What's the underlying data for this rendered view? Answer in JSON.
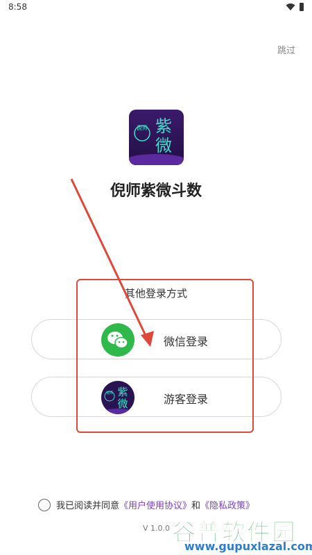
{
  "status": {
    "time": "8:58"
  },
  "header": {
    "skip_label": "跳过"
  },
  "app": {
    "name": "倪师紫微斗数",
    "logo_small": "倪师",
    "logo_big_1": "紫",
    "logo_big_2": "微"
  },
  "login": {
    "other_methods_title": "其他登录方式",
    "wechat_label": "微信登录",
    "guest_label": "游客登录"
  },
  "agreement": {
    "prefix": "我已阅读并同意",
    "user_agreement": "《用户使用协议》",
    "and": "和",
    "privacy_policy": "《隐私政策》"
  },
  "version": "V 1.0.0",
  "watermark": {
    "big": "谷普软件园",
    "small": "www.gupuxlazal.com"
  },
  "colors": {
    "accent_purple": "#7b3fd1",
    "wechat_green": "#2fb94a",
    "highlight_red": "#e0463a"
  }
}
